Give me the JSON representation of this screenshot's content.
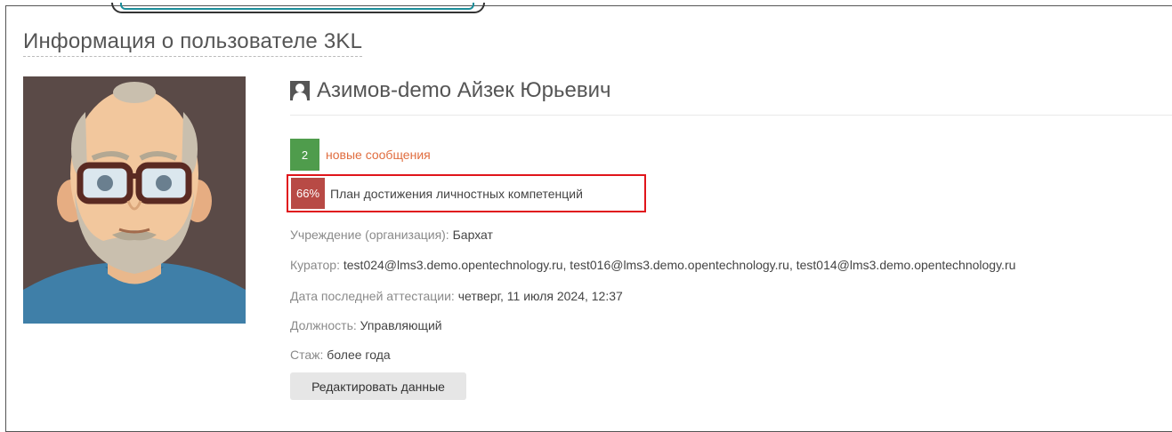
{
  "block": {
    "title": "Информация о пользователе 3KL"
  },
  "user": {
    "icon": "user-icon",
    "full_name": "Азимов-demo Айзек Юрьевич"
  },
  "messages": {
    "count": "2",
    "label": "новые сообщения",
    "badge_color": "#4f9c4c"
  },
  "competence_plan": {
    "percent": "66%",
    "label": "План достижения личностных компетенций",
    "badge_color": "#b84a45"
  },
  "info": {
    "organization_label": "Учреждение (организация):",
    "organization_value": "Бархат",
    "curator_label": "Куратор:",
    "curator_value": "test024@lms3.demo.opentechnology.ru, test016@lms3.demo.opentechnology.ru, test014@lms3.demo.opentechnology.ru",
    "attestation_label": "Дата последней аттестации:",
    "attestation_value": "четверг, 11 июля 2024, 12:37",
    "position_label": "Должность:",
    "position_value": "Управляющий",
    "experience_label": "Стаж:",
    "experience_value": "более года"
  },
  "actions": {
    "edit_label": "Редактировать данные"
  }
}
